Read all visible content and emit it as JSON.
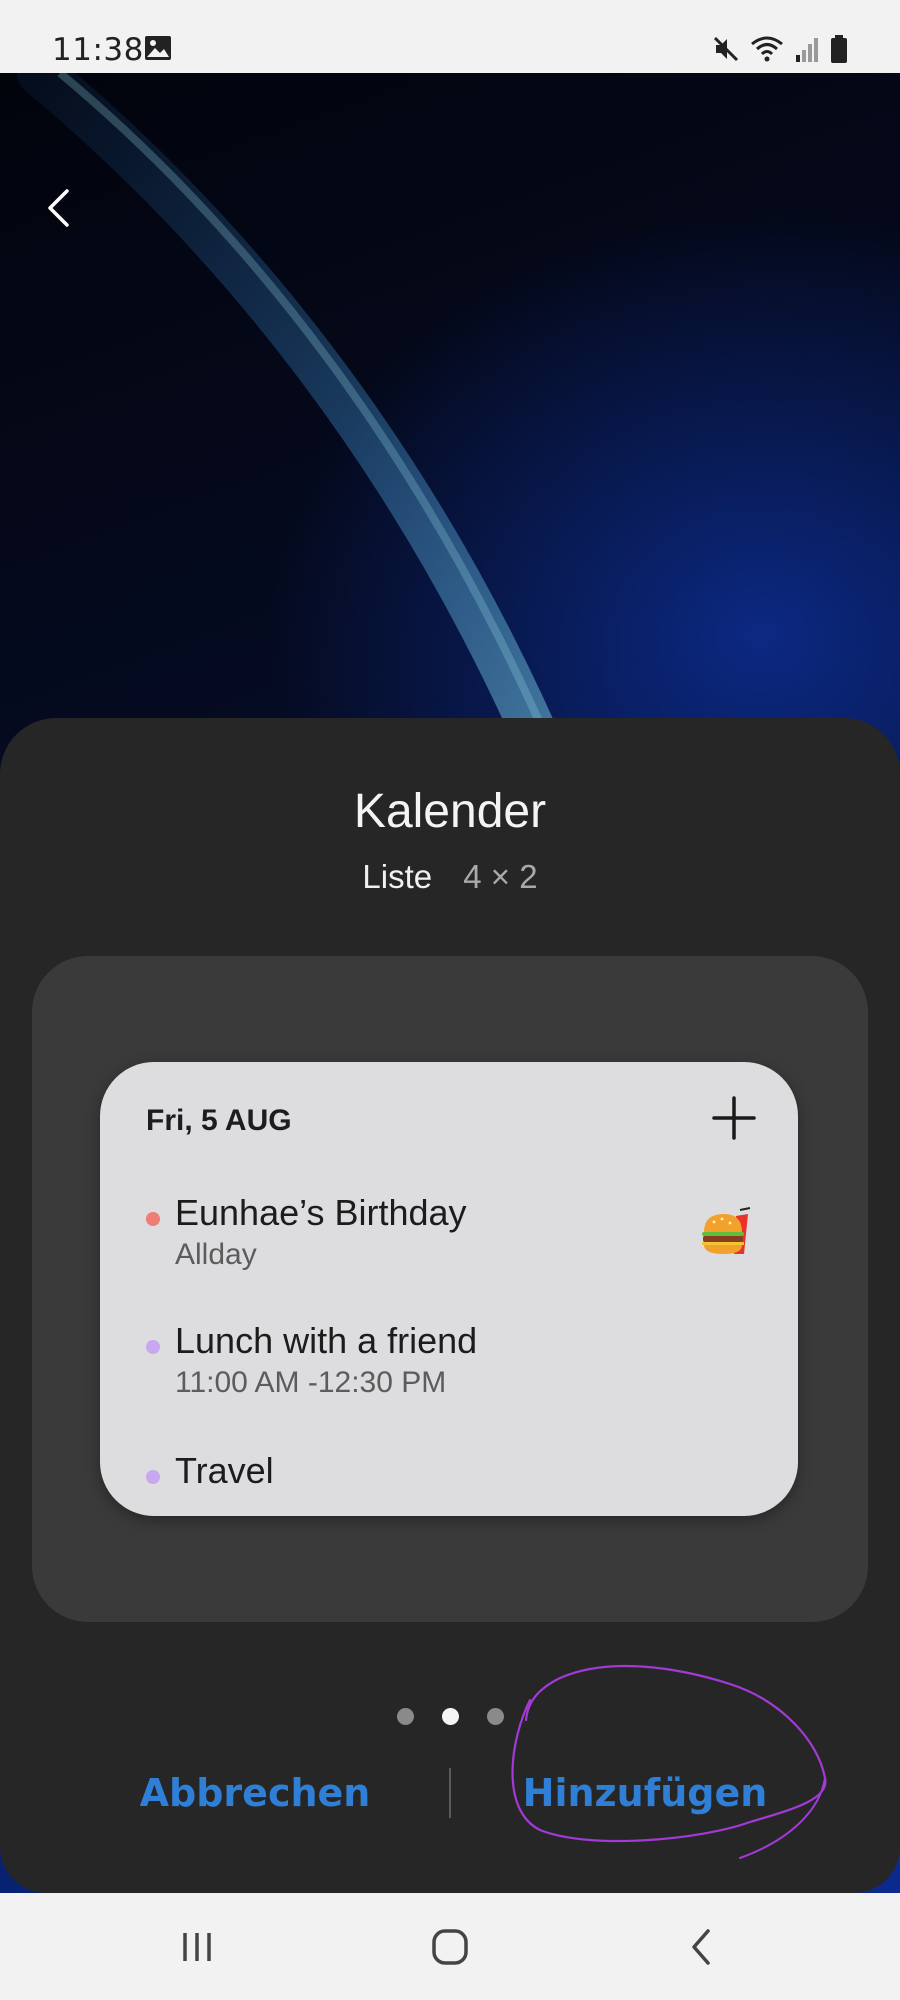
{
  "status_bar": {
    "time": "11:38",
    "icons": [
      "gallery-icon",
      "mute-icon",
      "wifi-icon",
      "signal-icon",
      "battery-icon"
    ]
  },
  "header": {
    "back_icon": "chevron-left-icon"
  },
  "sheet": {
    "title": "Kalender",
    "subtitle_name": "Liste",
    "subtitle_size": "4 × 2",
    "widget": {
      "date": "Fri, 5 AUG",
      "add_icon": "plus-icon",
      "events": [
        {
          "title": "Eunhae’s Birthday",
          "subtitle": "Allday",
          "dot_color": "#ee7d75",
          "sticker": "burger-icon"
        },
        {
          "title": "Lunch with a friend",
          "subtitle": "11:00 AM -12:30 PM",
          "dot_color": "#c9a7f0"
        },
        {
          "title": "Travel",
          "subtitle": "",
          "dot_color": "#c9a7f0"
        }
      ]
    },
    "pagination": {
      "total": 3,
      "active_index": 1
    },
    "actions": {
      "cancel_label": "Abbrechen",
      "add_label": "Hinzufügen"
    }
  },
  "nav_bar": {
    "icons": [
      "recents-icon",
      "home-icon",
      "back-icon"
    ]
  },
  "colors": {
    "accent": "#2f7fd6",
    "sheet_bg": "#262626",
    "preview_bg": "#3a3a3a",
    "widget_bg": "#dddcdf",
    "annotation": "#a23ad6"
  }
}
